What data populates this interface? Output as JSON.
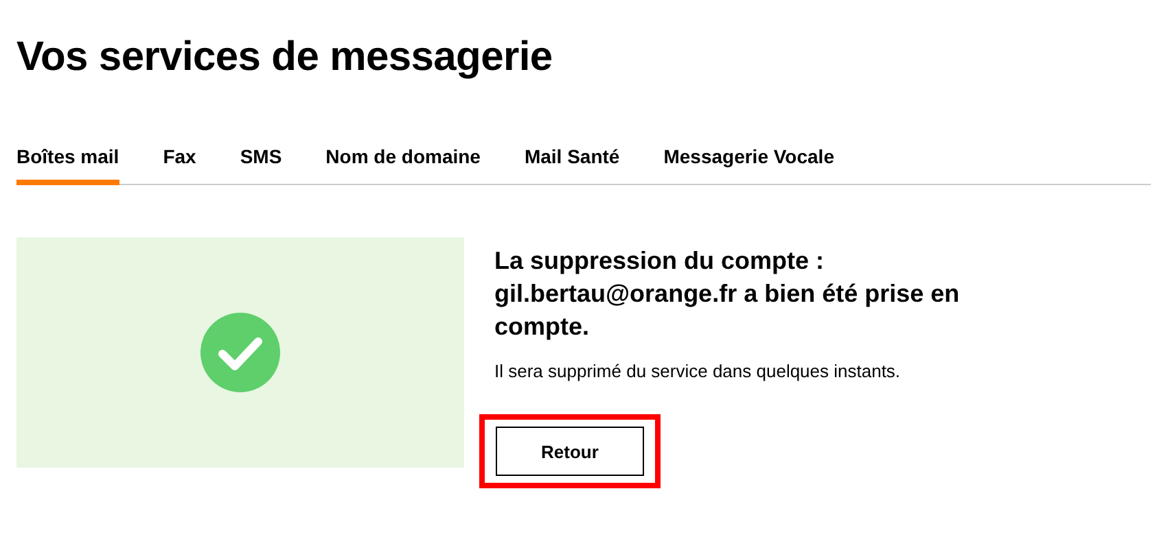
{
  "page_title": "Vos services de messagerie",
  "tabs": [
    {
      "label": "Boîtes mail",
      "selected": true
    },
    {
      "label": "Fax",
      "selected": false
    },
    {
      "label": "SMS",
      "selected": false
    },
    {
      "label": "Nom de domaine",
      "selected": false
    },
    {
      "label": "Mail Santé",
      "selected": false
    },
    {
      "label": "Messagerie Vocale",
      "selected": false
    }
  ],
  "confirmation": {
    "heading": "La suppression du compte : gil.bertau@orange.fr a bien été prise en compte.",
    "message": "Il sera supprimé du service dans quelques instants.",
    "button": "Retour",
    "highlighted": true
  }
}
